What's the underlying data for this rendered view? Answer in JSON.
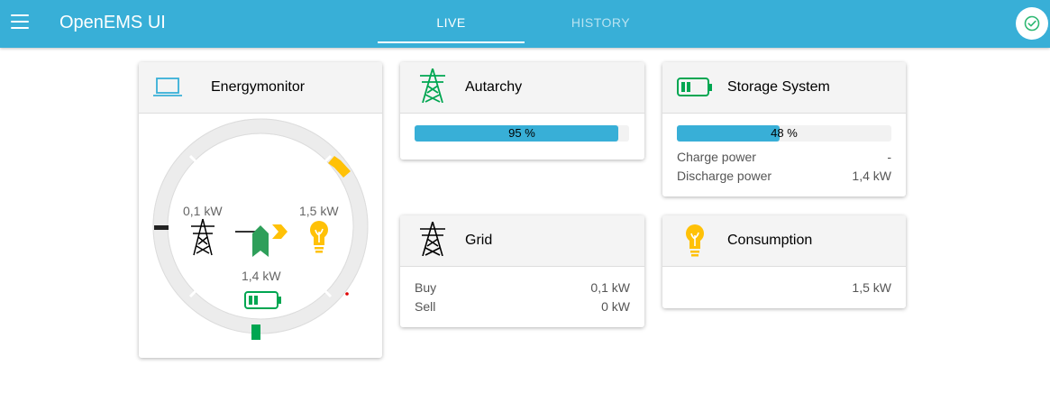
{
  "app": {
    "title": "OpenEMS UI"
  },
  "tabs": [
    {
      "label": "LIVE"
    },
    {
      "label": "HISTORY"
    }
  ],
  "colors": {
    "primary": "#38afd7",
    "grid": "#000000",
    "storage": "#00a651",
    "consumption": "#ffc107",
    "production": "#ffc107"
  },
  "energymonitor": {
    "title": "Energymonitor",
    "icon": "laptop-icon",
    "grid_value": "0,1 kW",
    "consumption_value": "1,5 kW",
    "storage_value": "1,4 kW"
  },
  "autarchy": {
    "title": "Autarchy",
    "icon": "power-tower-icon",
    "percent": 95,
    "percent_label": "95 %"
  },
  "storage": {
    "title": "Storage System",
    "icon": "battery-icon",
    "soc": 48,
    "soc_label": "48 %",
    "charge_label": "Charge power",
    "charge_value": "-",
    "discharge_label": "Discharge power",
    "discharge_value": "1,4 kW"
  },
  "grid": {
    "title": "Grid",
    "icon": "power-tower-icon",
    "buy_label": "Buy",
    "buy_value": "0,1 kW",
    "sell_label": "Sell",
    "sell_value": "0 kW"
  },
  "consumption": {
    "title": "Consumption",
    "icon": "lightbulb-icon",
    "value": "1,5 kW"
  }
}
